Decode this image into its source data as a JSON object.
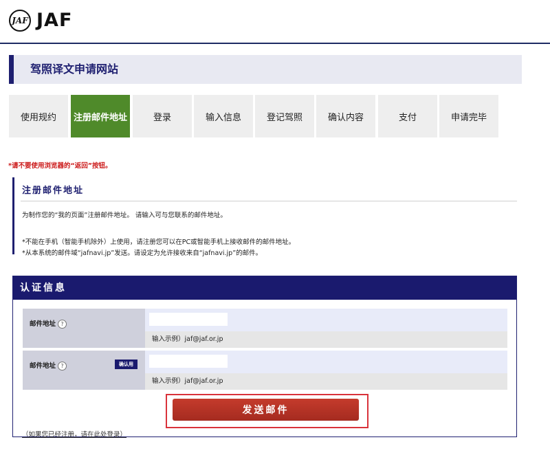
{
  "header": {
    "emblem_text": "JAF",
    "logo_text": "JAF"
  },
  "site_title": "驾照译文申请网站",
  "steps": [
    {
      "label": "使用规约",
      "active": false
    },
    {
      "label": "注册邮件地址",
      "active": true
    },
    {
      "label": "登录",
      "active": false
    },
    {
      "label": "输入信息",
      "active": false
    },
    {
      "label": "登记驾照",
      "active": false
    },
    {
      "label": "确认内容",
      "active": false
    },
    {
      "label": "支付",
      "active": false
    },
    {
      "label": "申请完毕",
      "active": false
    }
  ],
  "warning": "*请不要使用浏览器的“返回”按钮。",
  "section": {
    "title": "注册邮件地址",
    "intro": "为制作您的“我的页面”注册邮件地址。 请输入可与您联系的邮件地址。",
    "note1": "*不能在手机（智能手机除外）上使用，请注册您可以在PC或智能手机上接收邮件的邮件地址。",
    "note2": "*从本系统的邮件域“jafnavi.jp”发送。请设定为允许接收来自“jafnavi.jp”的邮件。"
  },
  "auth": {
    "header": "认证信息",
    "email": {
      "label": "邮件地址",
      "help": "?",
      "value": "",
      "example": "输入示例）jaf@jaf.or.jp"
    },
    "email_confirm": {
      "label": "邮件地址",
      "help": "?",
      "badge": "确认用",
      "value": "",
      "example": "输入示例）jaf@jaf.or.jp"
    },
    "send_button": "发送邮件",
    "login_link": "（如果您已经注册，请在此处登录）"
  },
  "colors": {
    "navy": "#1e1f70",
    "active_step": "#4f8a2a",
    "send_button": "#c53b2c",
    "warning": "#cc1b1b"
  }
}
